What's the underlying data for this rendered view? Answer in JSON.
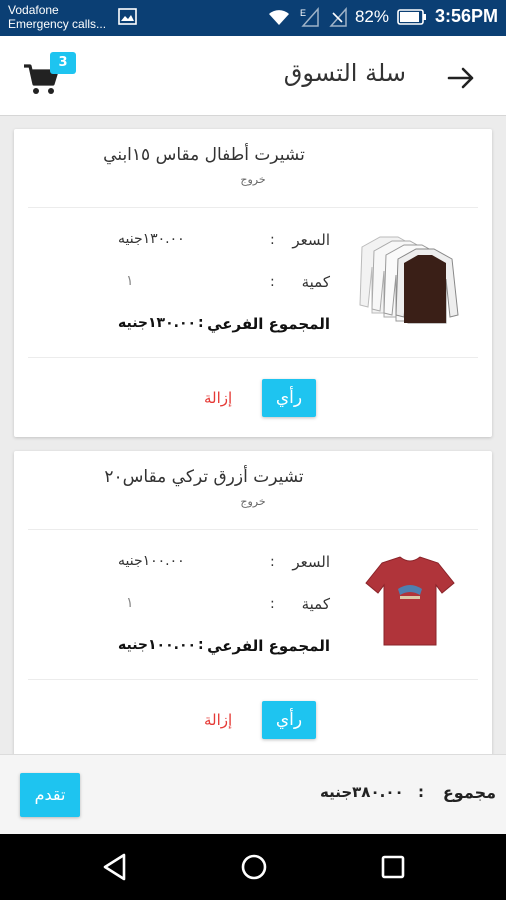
{
  "status_bar": {
    "carrier": "Vodafone",
    "emergency": "Emergency calls...",
    "battery": "82%",
    "time": "3:56PM",
    "icons": [
      "image-icon",
      "wifi-icon",
      "signal-e-icon",
      "signal-muted-icon",
      "battery-icon"
    ]
  },
  "app_bar": {
    "title": "سلة التسوق",
    "cart_count": "3"
  },
  "items": [
    {
      "name": "تشيرت أطفال مقاس ١٥ابني",
      "status": "خروج",
      "price_label": "السعر",
      "price_value": "١٣٠.٠٠جنيه",
      "qty_label": "كمية",
      "qty_value": "١",
      "subtotal_label": "المجموع الفرعي",
      "subtotal_value": "١٣٠.٠٠جنيه",
      "view_label": "رأي",
      "remove_label": "إزالة"
    },
    {
      "name": "تشيرت أزرق تركي مقاس٢٠",
      "status": "خروج",
      "price_label": "السعر",
      "price_value": "١٠٠.٠٠جنيه",
      "qty_label": "كمية",
      "qty_value": "١",
      "subtotal_label": "المجموع الفرعي",
      "subtotal_value": "١٠٠.٠٠جنيه",
      "view_label": "رأي",
      "remove_label": "إزالة"
    }
  ],
  "footer": {
    "total_label": "مجموع",
    "total_value": "٣٨٠.٠٠جنيه",
    "proceed_label": "تقدم"
  },
  "colors": {
    "accent": "#1ec4f0",
    "status_bar": "#0b3f74",
    "remove": "#e53935"
  }
}
